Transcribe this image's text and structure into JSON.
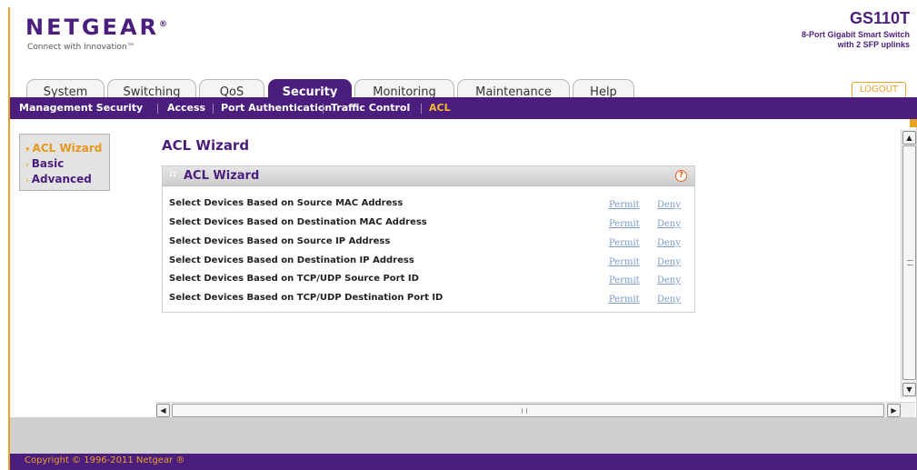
{
  "header": {
    "brand": "NETGEAR",
    "brand_mark": "®",
    "tagline": "Connect with Innovation™",
    "model": "GS110T",
    "model_description_line1": "8-Port Gigabit Smart Switch",
    "model_description_line2": "with 2 SFP uplinks",
    "logout_label": "LOGOUT"
  },
  "tabs": [
    {
      "label": "System",
      "active": false
    },
    {
      "label": "Switching",
      "active": false
    },
    {
      "label": "QoS",
      "active": false
    },
    {
      "label": "Security",
      "active": true
    },
    {
      "label": "Monitoring",
      "active": false
    },
    {
      "label": "Maintenance",
      "active": false
    },
    {
      "label": "Help",
      "active": false
    }
  ],
  "subnav": [
    {
      "label": "Management Security",
      "active": false
    },
    {
      "label": "Access",
      "active": false
    },
    {
      "label": "Port Authentication",
      "active": false
    },
    {
      "label": "Traffic Control",
      "active": false
    },
    {
      "label": "ACL",
      "active": true
    }
  ],
  "leftnav": [
    {
      "label": "ACL Wizard",
      "active": true,
      "icon": "chevron-down-icon"
    },
    {
      "label": "Basic",
      "active": false,
      "icon": "chevron-right-icon"
    },
    {
      "label": "Advanced",
      "active": false,
      "icon": "chevron-right-icon"
    }
  ],
  "page": {
    "title": "ACL Wizard",
    "panel_title": "ACL Wizard",
    "help_glyph": "?",
    "rows": [
      {
        "label": "Select Devices Based on Source MAC Address",
        "permit": "Permit",
        "deny": "Deny"
      },
      {
        "label": "Select Devices Based on Destination MAC Address",
        "permit": "Permit",
        "deny": "Deny"
      },
      {
        "label": "Select Devices Based on Source IP Address",
        "permit": "Permit",
        "deny": "Deny"
      },
      {
        "label": "Select Devices Based on Destination IP Address",
        "permit": "Permit",
        "deny": "Deny"
      },
      {
        "label": "Select Devices Based on TCP/UDP Source Port ID",
        "permit": "Permit",
        "deny": "Deny"
      },
      {
        "label": "Select Devices Based on TCP/UDP Destination Port ID",
        "permit": "Permit",
        "deny": "Deny"
      }
    ]
  },
  "footer": {
    "copyright": "Copyright © 1996-2011 Netgear ®"
  },
  "colors": {
    "brand_purple": "#4b1e7e",
    "accent_orange": "#e8a224",
    "link_blue": "#7a9cc8"
  }
}
